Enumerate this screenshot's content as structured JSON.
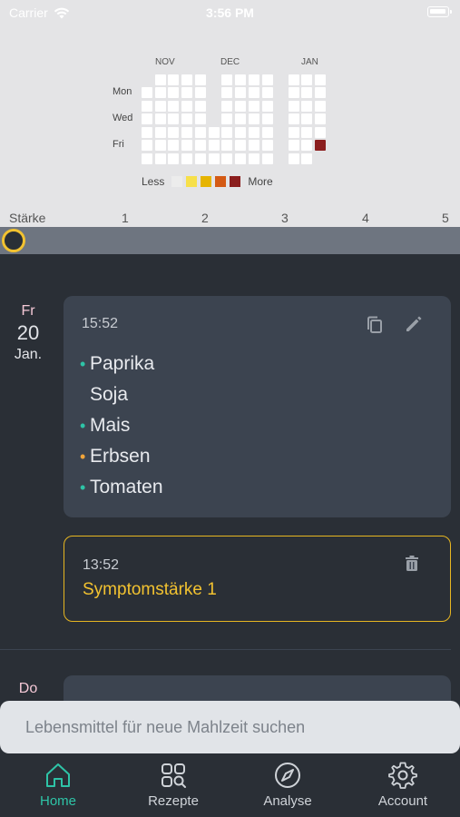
{
  "status_bar": {
    "carrier": "Carrier",
    "time": "3:56 PM"
  },
  "heatmap": {
    "months": [
      "NOV",
      "DEC",
      "JAN"
    ],
    "day_labels": [
      "Mon",
      "Wed",
      "Fri"
    ],
    "legend": {
      "less": "Less",
      "more": "More",
      "colors": [
        "#ececec",
        "#f7e04a",
        "#e6b400",
        "#d45a14",
        "#8b1e1e"
      ]
    },
    "highlight_color": "#8b1e1e"
  },
  "scale": {
    "label": "Stärke",
    "ticks": [
      "1",
      "2",
      "3",
      "4",
      "5"
    ]
  },
  "slider": {
    "value": 0,
    "min": 0,
    "max": 5
  },
  "feed": {
    "day": {
      "weekday": "Fr",
      "day": "20",
      "month": "Jan."
    },
    "meal": {
      "time": "15:52",
      "foods": [
        {
          "name": "Paprika",
          "dot_color": "#2ec4a7"
        },
        {
          "name": "Soja",
          "dot_color": ""
        },
        {
          "name": "Mais",
          "dot_color": "#2ec4a7"
        },
        {
          "name": "Erbsen",
          "dot_color": "#f2a53a"
        },
        {
          "name": "Tomaten",
          "dot_color": "#2ec4a7"
        }
      ]
    },
    "symptom": {
      "time": "13:52",
      "title": "Symptomstärke 1"
    },
    "next_day": {
      "weekday": "Do"
    }
  },
  "search": {
    "placeholder": "Lebensmittel für neue Mahlzeit suchen"
  },
  "tabs": [
    {
      "label": "Home",
      "icon": "home-icon",
      "active": true
    },
    {
      "label": "Rezepte",
      "icon": "recipes-icon",
      "active": false
    },
    {
      "label": "Analyse",
      "icon": "compass-icon",
      "active": false
    },
    {
      "label": "Account",
      "icon": "gear-icon",
      "active": false
    }
  ],
  "colors": {
    "accent": "#2ec4a7",
    "warning": "#f2c230",
    "background": "#2a2f36",
    "card": "#3c4450"
  }
}
